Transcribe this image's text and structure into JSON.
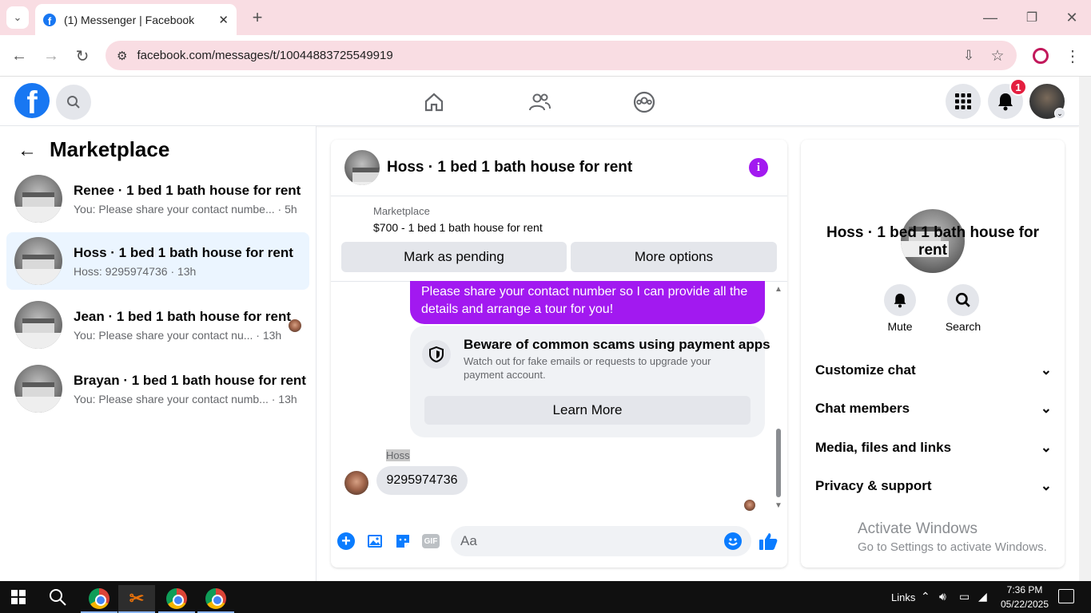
{
  "browser": {
    "tab_title": "(1) Messenger | Facebook",
    "new_tab": "+",
    "url": "facebook.com/messages/t/10044883725549919"
  },
  "header": {
    "notifications_badge": "1"
  },
  "left": {
    "title": "Marketplace",
    "conversations": [
      {
        "name": "Renee · 1 bed 1 bath house for rent",
        "preview": "You: Please share your contact numbe...",
        "time": "· 5h"
      },
      {
        "name": "Hoss · 1 bed 1 bath house for rent",
        "preview": "Hoss: 9295974736",
        "time": "· 13h"
      },
      {
        "name": "Jean · 1 bed 1 bath house for rent",
        "preview": "You: Please share your contact nu...",
        "time": "· 13h"
      },
      {
        "name": "Brayan · 1 bed 1 bath house for rent",
        "preview": "You: Please share your contact numb...",
        "time": "· 13h"
      }
    ]
  },
  "chat": {
    "title": "Hoss · 1 bed 1 bath house for rent",
    "listing_source": "Marketplace",
    "listing": "$700 - 1 bed 1 bath house for rent",
    "mark_pending": "Mark as pending",
    "more_options": "More options",
    "sent_message": "Please share your contact number so I can provide all the details and arrange a tour for you!",
    "scam_title": "Beware of common scams using payment apps",
    "scam_body": "Watch out for fake emails or requests to upgrade your payment account.",
    "learn_more": "Learn More",
    "sender": "Hoss",
    "reply": "9295974736",
    "composer_placeholder": "Aa"
  },
  "details": {
    "title": "Hoss · 1 bed 1 bath house for rent",
    "mute": "Mute",
    "search": "Search",
    "sections": [
      "Customize chat",
      "Chat members",
      "Media, files and links",
      "Privacy & support"
    ]
  },
  "watermark": {
    "line1": "Activate Windows",
    "line2": "Go to Settings to activate Windows."
  },
  "taskbar": {
    "links": "Links",
    "time": "7:36 PM",
    "date": "05/22/2025"
  }
}
